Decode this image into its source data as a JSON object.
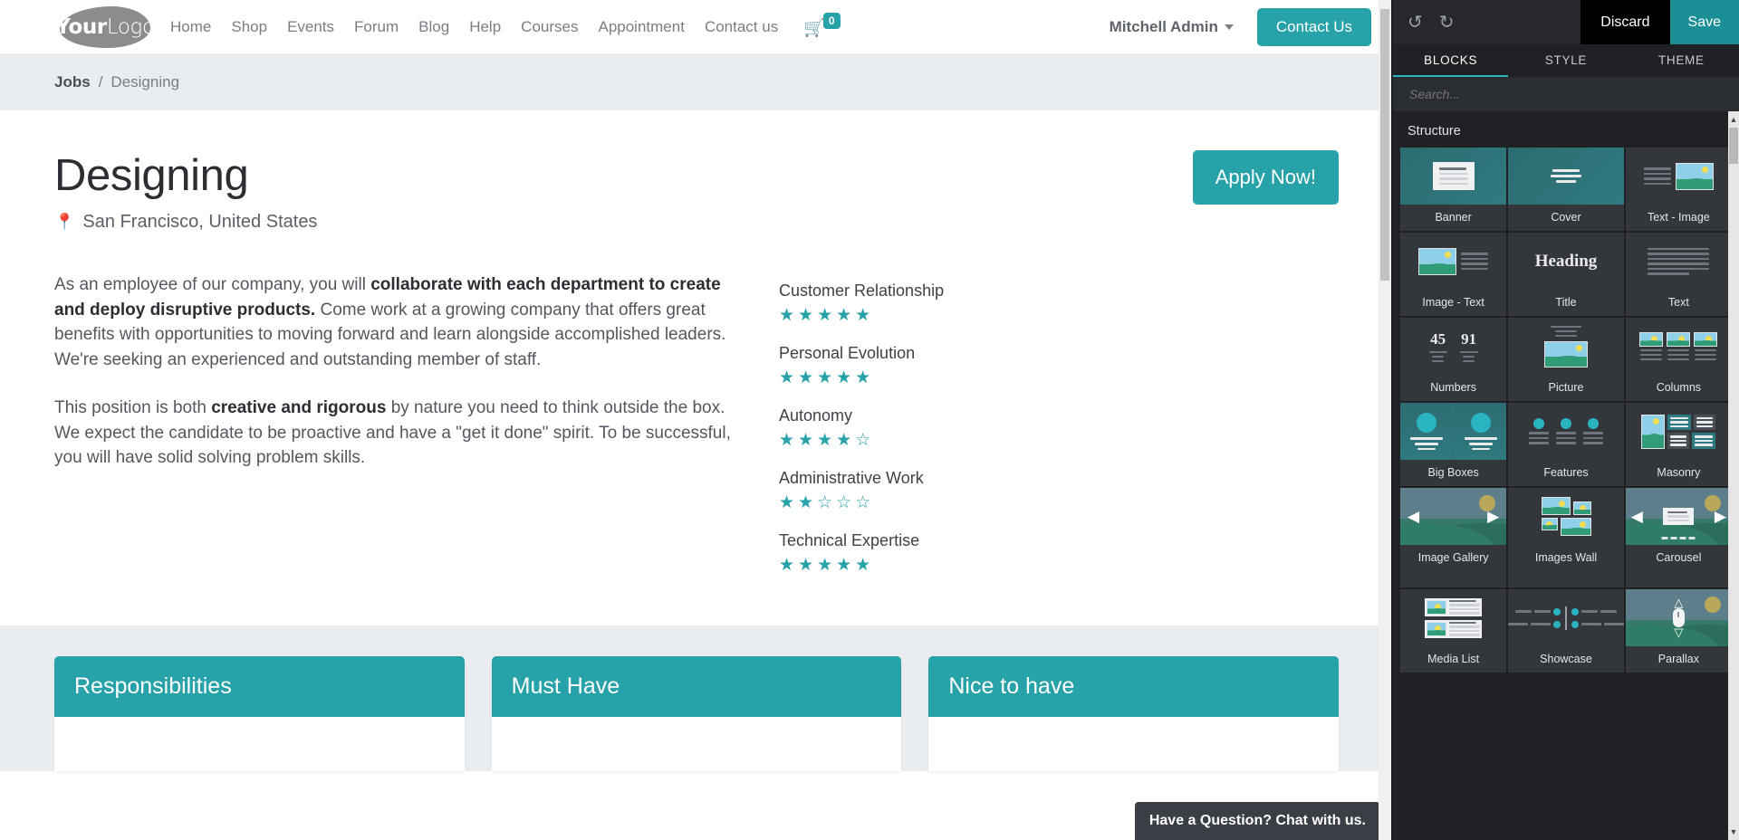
{
  "site": {
    "logo": {
      "bold": "Your",
      "light": "Logo"
    },
    "nav_links": [
      "Home",
      "Shop",
      "Events",
      "Forum",
      "Blog",
      "Help",
      "Courses",
      "Appointment",
      "Contact us"
    ],
    "cart": {
      "icon": "cart-icon",
      "count": "0"
    },
    "user": "Mitchell Admin",
    "contact_button": "Contact Us",
    "breadcrumb": {
      "root": "Jobs",
      "separator": "/",
      "current": "Designing"
    },
    "hero": {
      "title": "Designing",
      "location_icon": "map-pin-icon",
      "location": "San Francisco, United States",
      "apply_button": "Apply Now!"
    },
    "paragraphs": [
      {
        "parts": [
          {
            "text": "As an employee of our company, you will ",
            "bold": false
          },
          {
            "text": "collaborate with each department to create and deploy disruptive products.",
            "bold": true
          },
          {
            "text": " Come work at a growing company that offers great benefits with opportunities to moving forward and learn alongside accomplished leaders. We're seeking an experienced and outstanding member of staff.",
            "bold": false
          }
        ]
      },
      {
        "parts": [
          {
            "text": "This position is both ",
            "bold": false
          },
          {
            "text": "creative and rigorous",
            "bold": true
          },
          {
            "text": " by nature you need to think outside the box. We expect the candidate to be proactive and have a \"get it done\" spirit. To be successful, you will have solid solving problem skills.",
            "bold": false
          }
        ]
      }
    ],
    "skills": [
      {
        "name": "Customer Relationship",
        "rating": 5,
        "max": 5
      },
      {
        "name": "Personal Evolution",
        "rating": 5,
        "max": 5
      },
      {
        "name": "Autonomy",
        "rating": 4,
        "max": 5
      },
      {
        "name": "Administrative Work",
        "rating": 2,
        "max": 5
      },
      {
        "name": "Technical Expertise",
        "rating": 5,
        "max": 5
      }
    ],
    "cards": [
      {
        "title": "Responsibilities"
      },
      {
        "title": "Must Have"
      },
      {
        "title": "Nice to have"
      }
    ],
    "chat_widget": "Have a Question? Chat with us.",
    "accent_color": "#27a2a8"
  },
  "editor": {
    "undo_icon": "undo-icon",
    "redo_icon": "redo-icon",
    "discard_label": "Discard",
    "save_label": "Save",
    "tabs": [
      {
        "label": "BLOCKS",
        "active": true
      },
      {
        "label": "STYLE",
        "active": false
      },
      {
        "label": "THEME",
        "active": false
      }
    ],
    "search_placeholder": "Search...",
    "section_title": "Structure",
    "blocks": [
      {
        "label": "Banner",
        "art": "banner"
      },
      {
        "label": "Cover",
        "art": "cover"
      },
      {
        "label": "Text - Image",
        "art": "text-image"
      },
      {
        "label": "Image - Text",
        "art": "image-text"
      },
      {
        "label": "Title",
        "art": "title",
        "art_text": "Heading"
      },
      {
        "label": "Text",
        "art": "text"
      },
      {
        "label": "Numbers",
        "art": "numbers",
        "art_text_1": "45",
        "art_text_2": "91"
      },
      {
        "label": "Picture",
        "art": "picture"
      },
      {
        "label": "Columns",
        "art": "columns"
      },
      {
        "label": "Big Boxes",
        "art": "big-boxes"
      },
      {
        "label": "Features",
        "art": "features"
      },
      {
        "label": "Masonry",
        "art": "masonry"
      },
      {
        "label": "Image Gallery",
        "art": "image-gallery"
      },
      {
        "label": "Images Wall",
        "art": "images-wall"
      },
      {
        "label": "Carousel",
        "art": "carousel"
      },
      {
        "label": "Media List",
        "art": "media-list"
      },
      {
        "label": "Showcase",
        "art": "showcase"
      },
      {
        "label": "Parallax",
        "art": "parallax"
      }
    ],
    "panel_bg": "#1f2125",
    "save_color": "#1a8f95",
    "active_tab_color": "#2ab3c0"
  }
}
